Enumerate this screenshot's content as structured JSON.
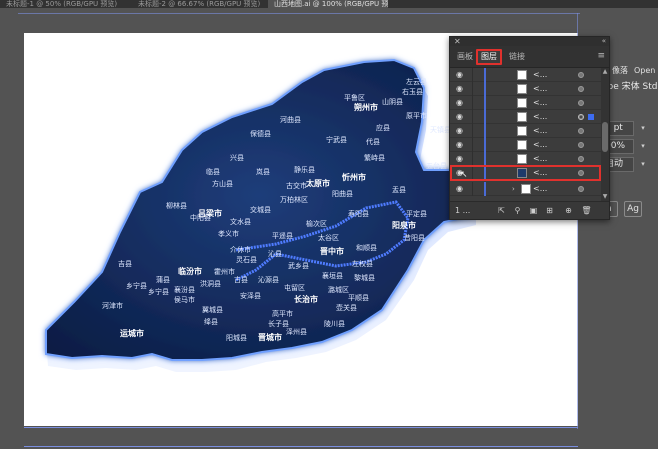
{
  "document_tabs": [
    {
      "label": "未标题-1 @ 50% (RGB/GPU 预览)"
    },
    {
      "label": "未标题-2 @ 66.67% (RGB/GPU 预览)"
    },
    {
      "label": "山西地图.ai @ 100% (RGB/GPU 预览)"
    }
  ],
  "layers_panel": {
    "tabs": [
      {
        "label": "画板"
      },
      {
        "label": "图层"
      },
      {
        "label": "链接"
      }
    ],
    "active_tab": "图层",
    "rows": [
      {
        "name": "<..."
      },
      {
        "name": "<..."
      },
      {
        "name": "<..."
      },
      {
        "name": "<..."
      },
      {
        "name": "<..."
      },
      {
        "name": "<..."
      },
      {
        "name": "<..."
      },
      {
        "name": "<..."
      },
      {
        "name": "<..."
      }
    ],
    "highlighted_row": 7,
    "layer_count": "1 ..."
  },
  "properties": {
    "font_name": "obe 宋体 Std",
    "font_tab": "Open",
    "font_tab2": "像落",
    "size_value": "2 pt",
    "scale_value": "00%",
    "tracking_value": "自动",
    "btn_a": "a",
    "btn_ag": "Ag"
  },
  "map_labels": [
    {
      "text": "左云县"
    },
    {
      "text": "右玉县"
    },
    {
      "text": "平鲁区"
    },
    {
      "text": "朔州市"
    },
    {
      "text": "山阴县"
    },
    {
      "text": "河曲县"
    },
    {
      "text": "保德县"
    },
    {
      "text": "宁武县"
    },
    {
      "text": "代县"
    },
    {
      "text": "繁峙县"
    },
    {
      "text": "原平市"
    },
    {
      "text": "五台县"
    },
    {
      "text": "兴县"
    },
    {
      "text": "临县"
    },
    {
      "text": "岚县"
    },
    {
      "text": "静乐县"
    },
    {
      "text": "忻州市"
    },
    {
      "text": "方山县"
    },
    {
      "text": "古交市"
    },
    {
      "text": "太原市"
    },
    {
      "text": "阳曲县"
    },
    {
      "text": "万柏林区"
    },
    {
      "text": "盂县"
    },
    {
      "text": "阳泉市"
    },
    {
      "text": "柳林县"
    },
    {
      "text": "吕梁市"
    },
    {
      "text": "交城县"
    },
    {
      "text": "中阳县"
    },
    {
      "text": "寿阳县"
    },
    {
      "text": "平定县"
    },
    {
      "text": "昔阳县"
    },
    {
      "text": "文水县"
    },
    {
      "text": "孝义市"
    },
    {
      "text": "平遥县"
    },
    {
      "text": "榆次区"
    },
    {
      "text": "太谷区"
    },
    {
      "text": "和顺县"
    },
    {
      "text": "晋中市"
    },
    {
      "text": "介休市"
    },
    {
      "text": "灵石县"
    },
    {
      "text": "左权县"
    },
    {
      "text": "吉县"
    },
    {
      "text": "蒲县"
    },
    {
      "text": "临汾市"
    },
    {
      "text": "霍州市"
    },
    {
      "text": "武乡县"
    },
    {
      "text": "乡宁县"
    },
    {
      "text": "洪洞县"
    },
    {
      "text": "襄垣县"
    },
    {
      "text": "黎城县"
    },
    {
      "text": "古县"
    },
    {
      "text": "沁源县"
    },
    {
      "text": "屯留区"
    },
    {
      "text": "长治市"
    },
    {
      "text": "潞城区"
    },
    {
      "text": "平顺县"
    },
    {
      "text": "河津市"
    },
    {
      "text": "翼城县"
    },
    {
      "text": "安泽县"
    },
    {
      "text": "壶关县"
    },
    {
      "text": "运城市"
    },
    {
      "text": "绛县"
    },
    {
      "text": "长子县"
    },
    {
      "text": "陵川县"
    },
    {
      "text": "阳城县"
    },
    {
      "text": "晋城市"
    },
    {
      "text": "高平市"
    },
    {
      "text": "泽州县"
    },
    {
      "text": "侯马市"
    },
    {
      "text": "乡宁县"
    },
    {
      "text": "襄汾县"
    },
    {
      "text": "沁县"
    },
    {
      "text": "应县"
    },
    {
      "text": "天镇县"
    }
  ]
}
